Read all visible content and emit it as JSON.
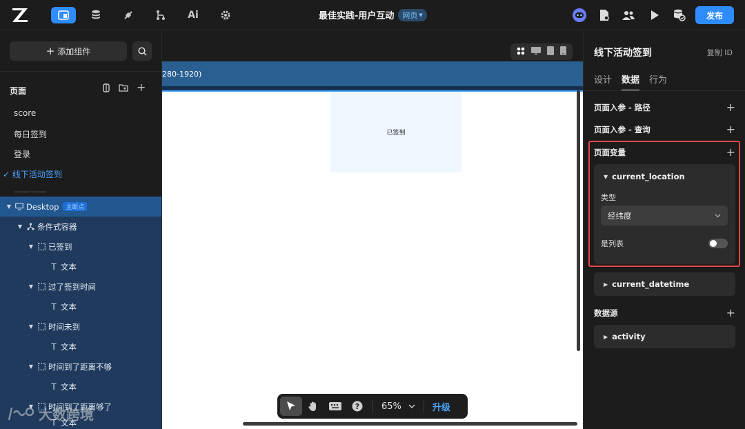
{
  "topbar": {
    "app_title": "最佳实践-用户互动",
    "badge": "网页",
    "publish_label": "发布",
    "nav_icons": [
      "layout-icon",
      "database-icon",
      "connector-icon",
      "workflow-icon",
      "ai-icon",
      "gear-icon"
    ]
  },
  "left": {
    "add_component_label": "添加组件",
    "pages_title": "页面",
    "pages": [
      "score",
      "每日签到",
      "登录",
      "线下活动签到"
    ],
    "active_page": "线下活动签到",
    "faded_page": "——·——",
    "tree": [
      {
        "label": "Desktop",
        "badge": "主断点"
      },
      {
        "label": "条件式容器"
      },
      {
        "label": "已签到"
      },
      {
        "label": "文本"
      },
      {
        "label": "过了签到时间"
      },
      {
        "label": "文本"
      },
      {
        "label": "时间未到"
      },
      {
        "label": "文本"
      },
      {
        "label": "时间到了距离不够"
      },
      {
        "label": "文本"
      },
      {
        "label": "时间到了距离够了"
      },
      {
        "label": "文本"
      }
    ],
    "watermark": "大数跨境"
  },
  "canvas": {
    "breakpoint_text": "280-1920)",
    "signed_text": "已签到",
    "zoom": "65%",
    "upgrade_label": "升级"
  },
  "right": {
    "title": "线下活动签到",
    "copy_id_label": "复制 ID",
    "tabs": [
      "设计",
      "数据",
      "行为"
    ],
    "active_tab": "数据",
    "section_path_params": "页面入参 - 路径",
    "section_query_params": "页面入参 - 查询",
    "section_page_vars": "页面变量",
    "var1": {
      "name": "current_location",
      "type_label": "类型",
      "type_value": "经纬度",
      "is_list_label": "是列表",
      "is_list": false
    },
    "var2_name": "current_datetime",
    "section_datasource": "数据源",
    "datasource_name": "activity"
  },
  "colors": {
    "accent": "#2f8cff",
    "highlight": "#e04848",
    "tree_bg": "#1f3a5c"
  }
}
